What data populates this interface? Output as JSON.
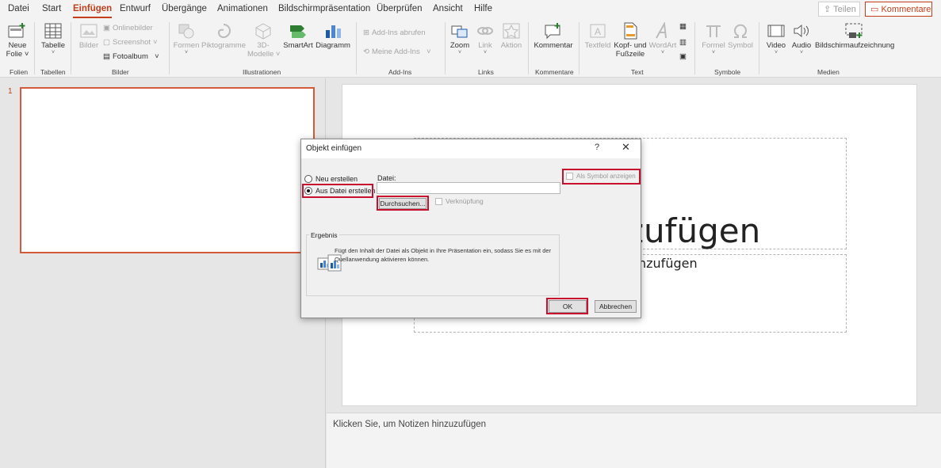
{
  "menu": {
    "tabs": [
      "Datei",
      "Start",
      "Einfügen",
      "Entwurf",
      "Übergänge",
      "Animationen",
      "Bildschirmpräsentation",
      "Überprüfen",
      "Ansicht",
      "Hilfe"
    ],
    "active_tab": "Einfügen",
    "share_label": "Teilen",
    "comments_label": "Kommentare"
  },
  "ribbon": {
    "folien": {
      "group": "Folien",
      "new_slide_line1": "Neue",
      "new_slide_line2": "Folie"
    },
    "tabellen": {
      "group": "Tabellen",
      "table": "Tabelle"
    },
    "bilder": {
      "group": "Bilder",
      "pictures": "Bilder",
      "online": "Onlinebilder",
      "screenshot": "Screenshot",
      "album": "Fotoalbum"
    },
    "illustrationen": {
      "group": "Illustrationen",
      "shapes": "Formen",
      "icons": "Piktogramme",
      "models_line1": "3D-",
      "models_line2": "Modelle",
      "smartart": "SmartArt",
      "chart": "Diagramm"
    },
    "addins": {
      "group": "Add-Ins",
      "get": "Add-Ins abrufen",
      "mine": "Meine Add-Ins"
    },
    "links": {
      "group": "Links",
      "zoom": "Zoom",
      "link": "Link",
      "action": "Aktion"
    },
    "kommentare": {
      "group": "Kommentare",
      "comment": "Kommentar"
    },
    "text": {
      "group": "Text",
      "textbox": "Textfeld",
      "header_line1": "Kopf- und",
      "header_line2": "Fußzeile",
      "wordart": "WordArt"
    },
    "symbole": {
      "group": "Symbole",
      "formula": "Formel",
      "symbol": "Symbol"
    },
    "medien": {
      "group": "Medien",
      "video": "Video",
      "audio": "Audio",
      "recording": "Bildschirmaufzeichnung"
    }
  },
  "slides": {
    "current_number": "1"
  },
  "slide": {
    "title_partial": "zufügen",
    "subtitle_partial": "nzufügen"
  },
  "notes": {
    "placeholder": "Klicken Sie, um Notizen hinzuzufügen"
  },
  "dialog": {
    "title": "Objekt einfügen",
    "help": "?",
    "close": "✕",
    "option_new": "Neu erstellen",
    "option_file": "Aus Datei erstellen",
    "file_label": "Datei:",
    "file_value": "",
    "browse": "Durchsuchen...",
    "link": "Verknüpfung",
    "show_as_icon": "Als Symbol anzeigen",
    "result_label": "Ergebnis",
    "result_text": "Fügt den Inhalt der Datei als Objekt in Ihre Präsentation ein, sodass Sie es mit der Quellanwendung aktivieren können.",
    "ok": "OK",
    "cancel": "Abbrechen"
  }
}
